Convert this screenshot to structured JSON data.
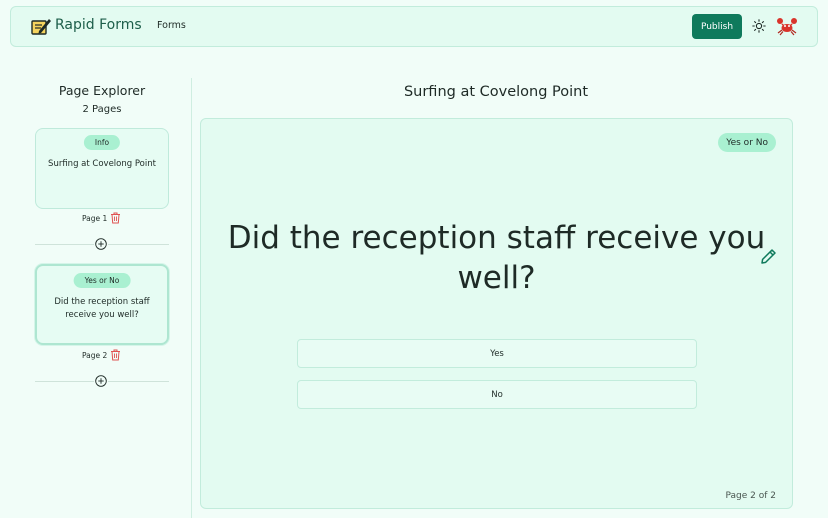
{
  "app": {
    "brand": "Rapid Forms"
  },
  "nav": {
    "forms_label": "Forms",
    "publish_label": "Publish"
  },
  "icons": {
    "logo": "notepad-pencil-icon",
    "theme": "sun-icon",
    "avatar": "crab-avatar-icon",
    "delete": "trash-icon",
    "add": "plus-circle-icon",
    "edit": "pencil-icon"
  },
  "colors": {
    "accent": "#0f7a5c",
    "badge": "#a9f0d1",
    "delete": "#e05252",
    "background": "#f1fdf8"
  },
  "sidebar": {
    "title": "Page Explorer",
    "count": "2 Pages",
    "pages": [
      {
        "badge": "Info",
        "text": "Surfing at Covelong Point",
        "label": "Page 1",
        "selected": false
      },
      {
        "badge": "Yes or No",
        "text": "Did the reception staff receive you well?",
        "label": "Page 2",
        "selected": true
      }
    ]
  },
  "main": {
    "title": "Surfing at Covelong Point",
    "type_badge": "Yes or No",
    "question": "Did the reception staff receive you well?",
    "options": [
      "Yes",
      "No"
    ],
    "page_indicator": "Page 2 of 2"
  }
}
